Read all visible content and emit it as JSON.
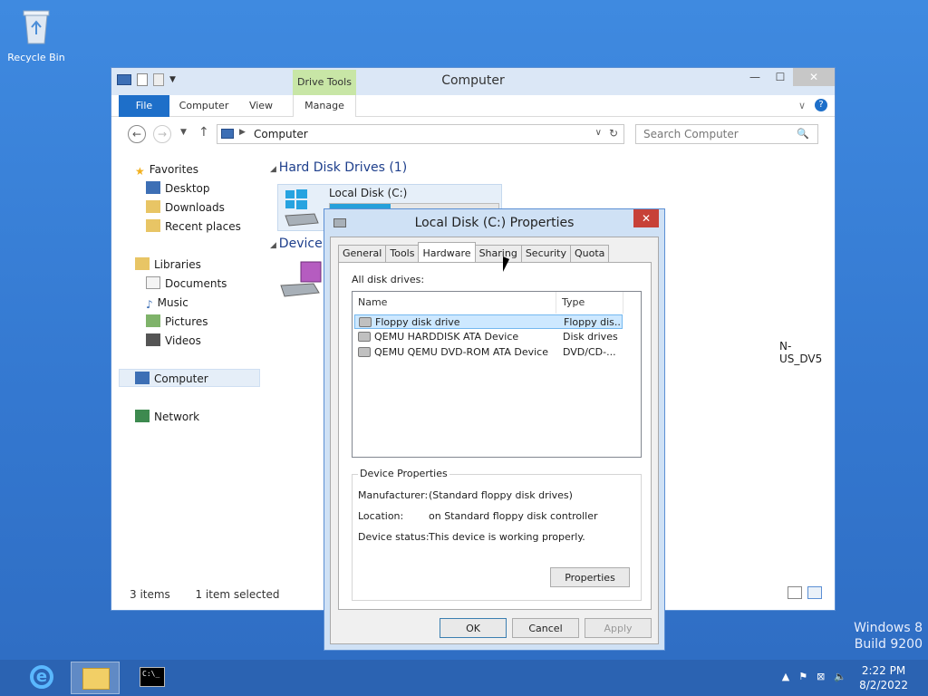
{
  "desktop": {
    "recycle_bin_label": "Recycle Bin",
    "watermark_line1": "Windows 8",
    "watermark_line2": "Build 9200"
  },
  "explorer": {
    "title": "Computer",
    "drive_tools_label": "Drive Tools",
    "ribbon_tabs": {
      "file": "File",
      "computer": "Computer",
      "view": "View",
      "manage": "Manage"
    },
    "address": "Computer",
    "search_placeholder": "Search Computer",
    "nav": {
      "favorites": "Favorites",
      "desktop": "Desktop",
      "downloads": "Downloads",
      "recent_places": "Recent places",
      "libraries": "Libraries",
      "documents": "Documents",
      "music": "Music",
      "pictures": "Pictures",
      "videos": "Videos",
      "computer": "Computer",
      "network": "Network"
    },
    "groups": {
      "hard_disk_drives": "Hard Disk Drives (1)",
      "devices": "Device"
    },
    "drive_c": {
      "name": "Local Disk (C:)",
      "used_fraction": 0.36
    },
    "dvd_label_fragment": "N-US_DV5",
    "status": {
      "items": "3 items",
      "selected": "1 item selected"
    }
  },
  "dialog": {
    "title": "Local Disk (C:) Properties",
    "tabs": [
      "General",
      "Tools",
      "Hardware",
      "Sharing",
      "Security",
      "Quota"
    ],
    "active_tab": "Hardware",
    "all_disk_drives_label": "All disk drives:",
    "columns": {
      "name": "Name",
      "type": "Type"
    },
    "drives": [
      {
        "name": "Floppy disk drive",
        "type": "Floppy dis..."
      },
      {
        "name": "QEMU HARDDISK ATA Device",
        "type": "Disk drives"
      },
      {
        "name": "QEMU QEMU DVD-ROM ATA Device",
        "type": "DVD/CD-..."
      }
    ],
    "device_properties": {
      "legend": "Device Properties",
      "manufacturer_label": "Manufacturer:",
      "manufacturer_value": "(Standard floppy disk drives)",
      "location_label": "Location:",
      "location_value": "on Standard floppy disk controller",
      "status_label": "Device status:",
      "status_value": "This device is working properly.",
      "properties_button": "Properties"
    },
    "buttons": {
      "ok": "OK",
      "cancel": "Cancel",
      "apply": "Apply"
    }
  },
  "taskbar": {
    "time": "2:22 PM",
    "date": "8/2/2022"
  }
}
